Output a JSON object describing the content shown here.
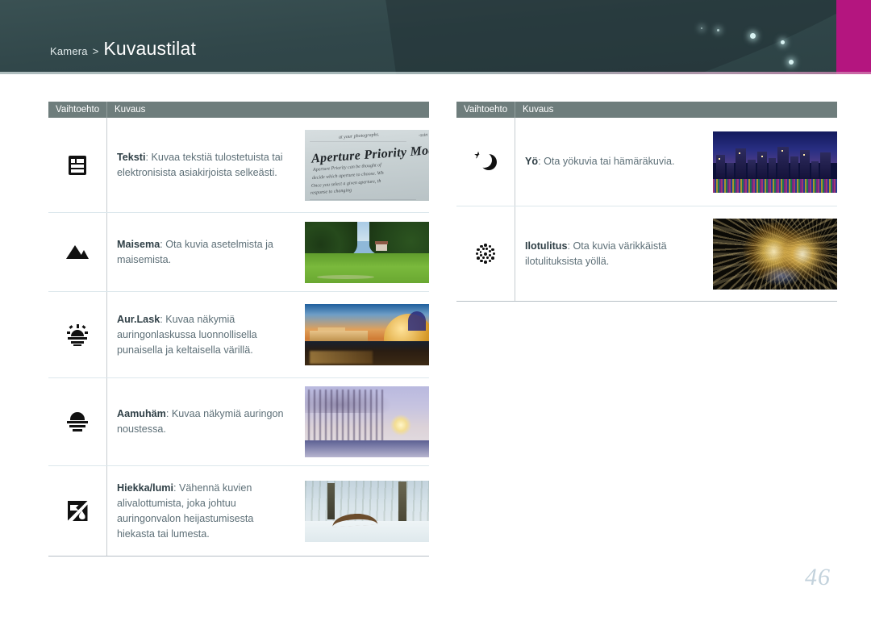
{
  "header": {
    "breadcrumb_parent": "Kamera",
    "breadcrumb_separator": ">",
    "title": "Kuvaustilat",
    "accent_color": "#b4157f",
    "background_color": "#31474a"
  },
  "tables": {
    "columns": [
      "Vaihtoehto",
      "Kuvaus"
    ],
    "left": {
      "header": {
        "option": "Vaihtoehto",
        "description": "Kuvaus"
      },
      "rows": [
        {
          "icon": "text-document-icon",
          "term": "Teksti",
          "separator": ":",
          "description": "Kuvaa tekstiä tulostetuista tai elektronisista asiakirjoista selkeästi.",
          "thumbnail": "printed-text-page-photo",
          "thumbnail_text": {
            "heading": "Aperture Priority Mode",
            "top_line": "at your photographs.",
            "lines": [
              "Aperture Priority can be thought of",
              "decide which aperture to choose. Wh",
              "Once you select a given aperture, th",
              "response to changing"
            ]
          }
        },
        {
          "icon": "mountain-landscape-icon",
          "term": "Maisema",
          "separator": ":",
          "description": "Ota kuvia asetelmista ja maisemista.",
          "thumbnail": "green-park-landscape-photo"
        },
        {
          "icon": "sunset-icon",
          "term": "Aur.Lask",
          "separator": ":",
          "description": "Kuvaa näkymiä auringonlaskussa luonnollisella punaisella ja keltaisella värillä.",
          "thumbnail": "golden-sunset-cityscape-photo"
        },
        {
          "icon": "sunrise-dawn-icon",
          "term": "Aamuhäm",
          "separator": ":",
          "description": "Kuvaa näkymiä auringon noustessa.",
          "thumbnail": "misty-winter-dawn-photo"
        },
        {
          "icon": "beach-snow-icon",
          "term": "Hiekka/lumi",
          "separator": ":",
          "description": "Vähennä kuvien alivalottumista, joka johtuu auringonvalon heijastumisesta hiekasta tai lumesta.",
          "thumbnail": "snowy-forest-photo"
        }
      ]
    },
    "right": {
      "header": {
        "option": "Vaihtoehto",
        "description": "Kuvaus"
      },
      "rows": [
        {
          "icon": "night-moon-star-icon",
          "term": "Yö",
          "separator": ":",
          "description": "Ota yökuvia tai hämäräkuvia.",
          "thumbnail": "night-city-skyline-photo"
        },
        {
          "icon": "fireworks-icon",
          "term": "Ilotulitus",
          "separator": ":",
          "description": "Ota kuvia värikkäistä ilotulituksista yöllä.",
          "thumbnail": "fireworks-photo"
        }
      ]
    }
  },
  "footer": {
    "page_number": "46"
  }
}
